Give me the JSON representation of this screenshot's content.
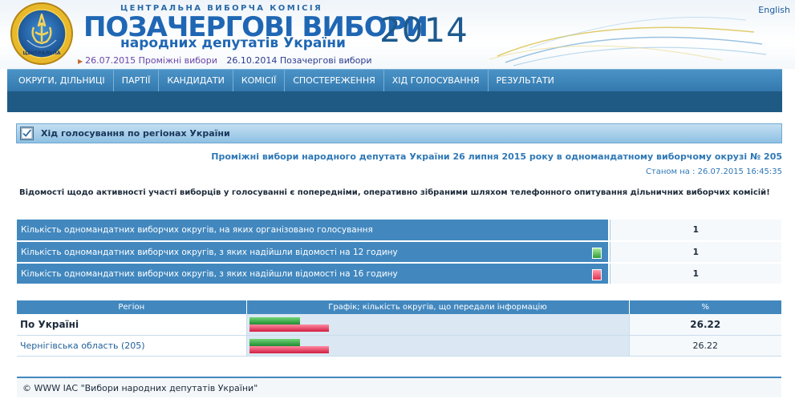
{
  "header": {
    "cvk": "ЦЕНТРАЛЬНА ВИБОРЧА КОМІСІЯ",
    "title_line1": "ПОЗАЧЕРГОВІ ВИБОРИ",
    "title_line2": "народних депутатів України",
    "year": "2014",
    "language_link": "English",
    "sub_links": [
      {
        "label": "26.07.2015 Проміжні вибори"
      },
      {
        "label": "26.10.2014 Позачергові вибори"
      }
    ],
    "emblem_text": "ЦЕНТРАЛЬНА"
  },
  "nav": {
    "items": [
      {
        "label": "ОКРУГИ, ДІЛЬНИЦІ"
      },
      {
        "label": "ПАРТІЇ"
      },
      {
        "label": "КАНДИДАТИ"
      },
      {
        "label": "КОМІСІЇ"
      },
      {
        "label": "СПОСТЕРЕЖЕННЯ"
      },
      {
        "label": "ХІД ГОЛОСУВАННЯ"
      },
      {
        "label": "РЕЗУЛЬТАТИ"
      }
    ]
  },
  "section": {
    "title": "Хід голосування по регіонах України",
    "election_line": "Проміжні вибори народного депутата України 26 липня 2015 року в одномандатному виборчому окрузі № 205",
    "status_line": "Станом на : 26.07.2015 16:45:35",
    "notice": "Відомості щодо активності участі виборців у голосуванні є попередніми, оперативно зібраними шляхом телефонного опитування дільничних виборчих комісій!"
  },
  "stats": {
    "rows": [
      {
        "label": "Кількість одномандатних виборчих округів, на яких організовано голосування",
        "legend": "",
        "value": "1"
      },
      {
        "label": "Кількість одномандатних виборчих округів, з яких надійшли відомості на 12 годину",
        "legend": "green",
        "value": "1"
      },
      {
        "label": "Кількість одномандатних виборчих округів, з яких надійшли відомості на 16 годину",
        "legend": "red",
        "value": "1"
      }
    ]
  },
  "regions": {
    "headers": {
      "region": "Регіон",
      "graph": "Графік; кількість округів, що передали інформацію",
      "percent": "%"
    },
    "rows": [
      {
        "name": "По Україні",
        "percent": "26.22",
        "bar_green": 0.141,
        "bar_red": 0.222
      },
      {
        "name": "Чернігівська область (205)",
        "percent": "26.22",
        "bar_green": 0.141,
        "bar_red": 0.222
      }
    ]
  },
  "footer": {
    "text": "© WWW ІАС \"Вибори народних депутатів України\""
  },
  "colors": {
    "nav_bg": "#3b84ba",
    "nav_dark": "#1f5a85",
    "table_header": "#4288bf",
    "title_blue": "#1f67b4",
    "bar_green": "#2a9a3a",
    "bar_red": "#e0314d"
  },
  "icons": {
    "emblem": "cvk-emblem-icon",
    "section": "checkbox-icon"
  }
}
